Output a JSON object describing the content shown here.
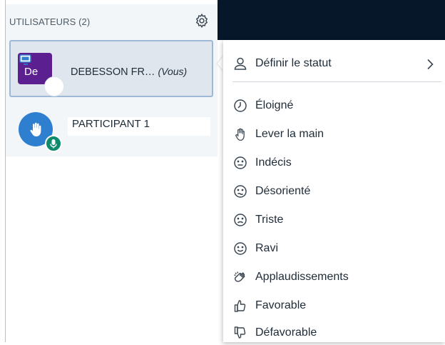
{
  "panel": {
    "title": "UTILISATEURS (2)",
    "users": [
      {
        "initials": "De",
        "name": "DEBESSON FR…",
        "you_label": "(Vous)",
        "avatar_color": "#5b1f8f"
      },
      {
        "name": "PARTICIPANT 1",
        "avatar_color": "#2f7fd1",
        "badge_color": "#0e8a6c"
      }
    ]
  },
  "menu": {
    "header_item": {
      "label": "Définir le statut",
      "icon": "user-icon"
    },
    "items": [
      {
        "label": "Éloigné",
        "icon": "clock-icon"
      },
      {
        "label": "Lever la main",
        "icon": "hand-raise-icon"
      },
      {
        "label": "Indécis",
        "icon": "neutral-face-icon"
      },
      {
        "label": "Désorienté",
        "icon": "confused-face-icon"
      },
      {
        "label": "Triste",
        "icon": "sad-face-icon"
      },
      {
        "label": "Ravi",
        "icon": "happy-face-icon"
      },
      {
        "label": "Applaudissements",
        "icon": "clapping-hands-icon"
      },
      {
        "label": "Favorable",
        "icon": "thumbs-up-icon"
      },
      {
        "label": "Défavorable",
        "icon": "thumbs-down-icon"
      }
    ]
  }
}
